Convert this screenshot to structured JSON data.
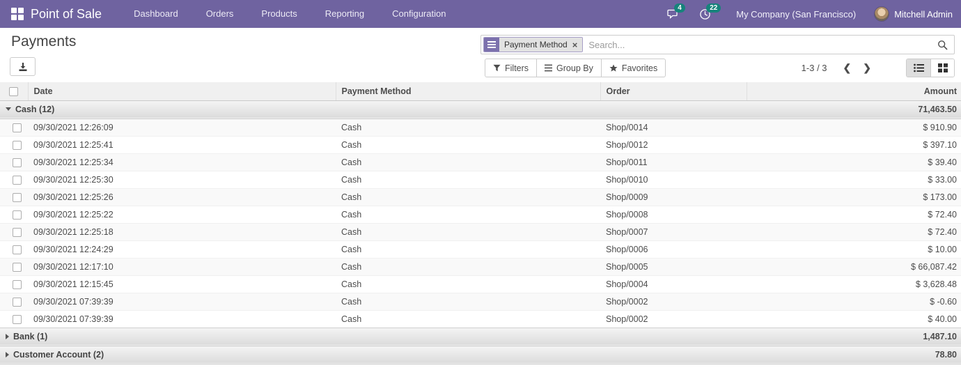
{
  "nav": {
    "brand": "Point of Sale",
    "menu_items": [
      "Dashboard",
      "Orders",
      "Products",
      "Reporting",
      "Configuration"
    ],
    "messages_badge": "4",
    "activities_badge": "22",
    "company": "My Company (San Francisco)",
    "user": "Mitchell Admin"
  },
  "colors": {
    "navbar": "#6f63a0",
    "badge_teal": "#16837b",
    "facet_purple": "#7c71ad"
  },
  "control_panel": {
    "title": "Payments",
    "search": {
      "facet_label": "Payment Method",
      "placeholder": "Search..."
    },
    "filters_label": "Filters",
    "groupby_label": "Group By",
    "favorites_label": "Favorites",
    "pager": "1-3 / 3"
  },
  "table": {
    "columns": [
      "Date",
      "Payment Method",
      "Order",
      "Amount"
    ],
    "groups": [
      {
        "label": "Cash (12)",
        "expanded": true,
        "total": "71,463.50",
        "rows": [
          {
            "date": "09/30/2021 12:26:09",
            "method": "Cash",
            "order": "Shop/0014",
            "amount": "$ 910.90"
          },
          {
            "date": "09/30/2021 12:25:41",
            "method": "Cash",
            "order": "Shop/0012",
            "amount": "$ 397.10"
          },
          {
            "date": "09/30/2021 12:25:34",
            "method": "Cash",
            "order": "Shop/0011",
            "amount": "$ 39.40"
          },
          {
            "date": "09/30/2021 12:25:30",
            "method": "Cash",
            "order": "Shop/0010",
            "amount": "$ 33.00"
          },
          {
            "date": "09/30/2021 12:25:26",
            "method": "Cash",
            "order": "Shop/0009",
            "amount": "$ 173.00"
          },
          {
            "date": "09/30/2021 12:25:22",
            "method": "Cash",
            "order": "Shop/0008",
            "amount": "$ 72.40"
          },
          {
            "date": "09/30/2021 12:25:18",
            "method": "Cash",
            "order": "Shop/0007",
            "amount": "$ 72.40"
          },
          {
            "date": "09/30/2021 12:24:29",
            "method": "Cash",
            "order": "Shop/0006",
            "amount": "$ 10.00"
          },
          {
            "date": "09/30/2021 12:17:10",
            "method": "Cash",
            "order": "Shop/0005",
            "amount": "$ 66,087.42"
          },
          {
            "date": "09/30/2021 12:15:45",
            "method": "Cash",
            "order": "Shop/0004",
            "amount": "$ 3,628.48"
          },
          {
            "date": "09/30/2021 07:39:39",
            "method": "Cash",
            "order": "Shop/0002",
            "amount": "$ -0.60"
          },
          {
            "date": "09/30/2021 07:39:39",
            "method": "Cash",
            "order": "Shop/0002",
            "amount": "$ 40.00"
          }
        ]
      },
      {
        "label": "Bank (1)",
        "expanded": false,
        "total": "1,487.10",
        "rows": []
      },
      {
        "label": "Customer Account (2)",
        "expanded": false,
        "total": "78.80",
        "rows": []
      }
    ]
  }
}
